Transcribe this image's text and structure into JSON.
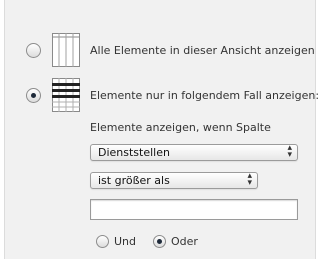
{
  "options": {
    "all_label": "Alle Elemente in dieser Ansicht anzeigen",
    "filtered_label": "Elemente nur in folgendem Fall anzeigen:",
    "selected": "filtered"
  },
  "filter": {
    "intro_label": "Elemente anzeigen, wenn Spalte",
    "column_value": "Dienststellen",
    "operator_value": "ist größer als",
    "value": "",
    "and_label": "Und",
    "or_label": "Oder",
    "logic_selected": "Oder"
  },
  "icons": {
    "all": "table-grid-icon",
    "filtered": "filtered-table-icon",
    "select_arrows": "updown-arrows-icon"
  },
  "colors": {
    "panel_bg": "#f1f1f1",
    "radio_dot": "#1e2a3a"
  }
}
